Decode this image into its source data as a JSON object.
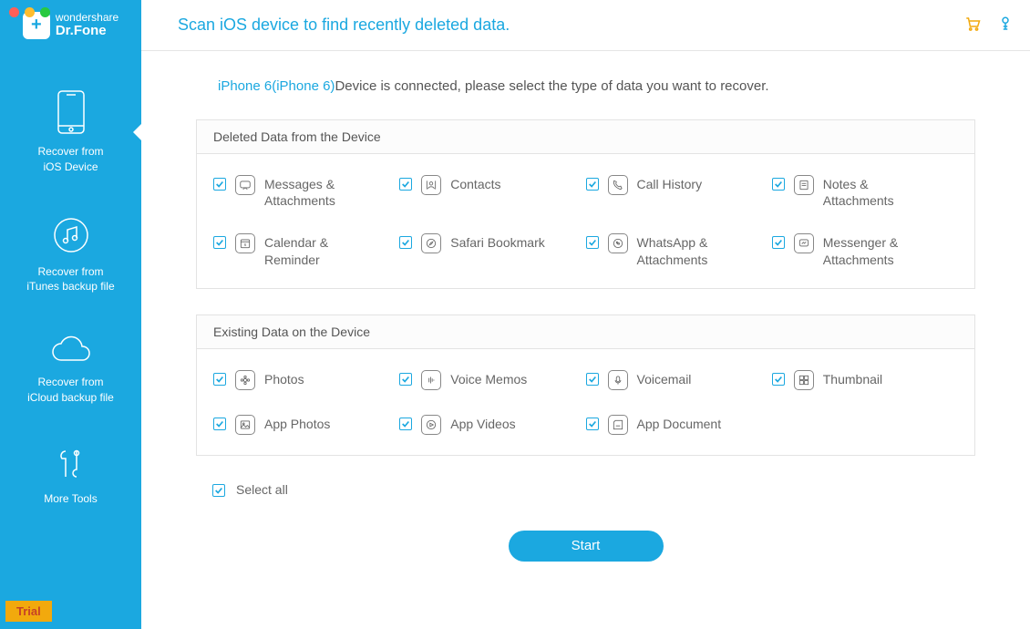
{
  "brand": {
    "top": "wondershare",
    "name": "Dr.Fone"
  },
  "header_title": "Scan iOS device to find recently deleted data.",
  "sidebar": {
    "items": [
      {
        "line1": "Recover from",
        "line2": "iOS Device"
      },
      {
        "line1": "Recover from",
        "line2": "iTunes backup file"
      },
      {
        "line1": "Recover from",
        "line2": "iCloud backup file"
      },
      {
        "line1": "More Tools",
        "line2": ""
      }
    ]
  },
  "trial_label": "Trial",
  "device_name": "iPhone 6(iPhone 6)",
  "device_msg": "Device is connected, please select the type of data you want to recover.",
  "section_deleted_title": "Deleted Data from the Device",
  "section_existing_title": "Existing Data on the Device",
  "deleted": [
    "Messages & Attachments",
    "Contacts",
    "Call History",
    "Notes & Attachments",
    "Calendar & Reminder",
    "Safari Bookmark",
    "WhatsApp & Attachments",
    "Messenger & Attachments"
  ],
  "existing": [
    "Photos",
    "Voice Memos",
    "Voicemail",
    "Thumbnail",
    "App Photos",
    "App Videos",
    "App Document"
  ],
  "select_all_label": "Select all",
  "start_label": "Start"
}
